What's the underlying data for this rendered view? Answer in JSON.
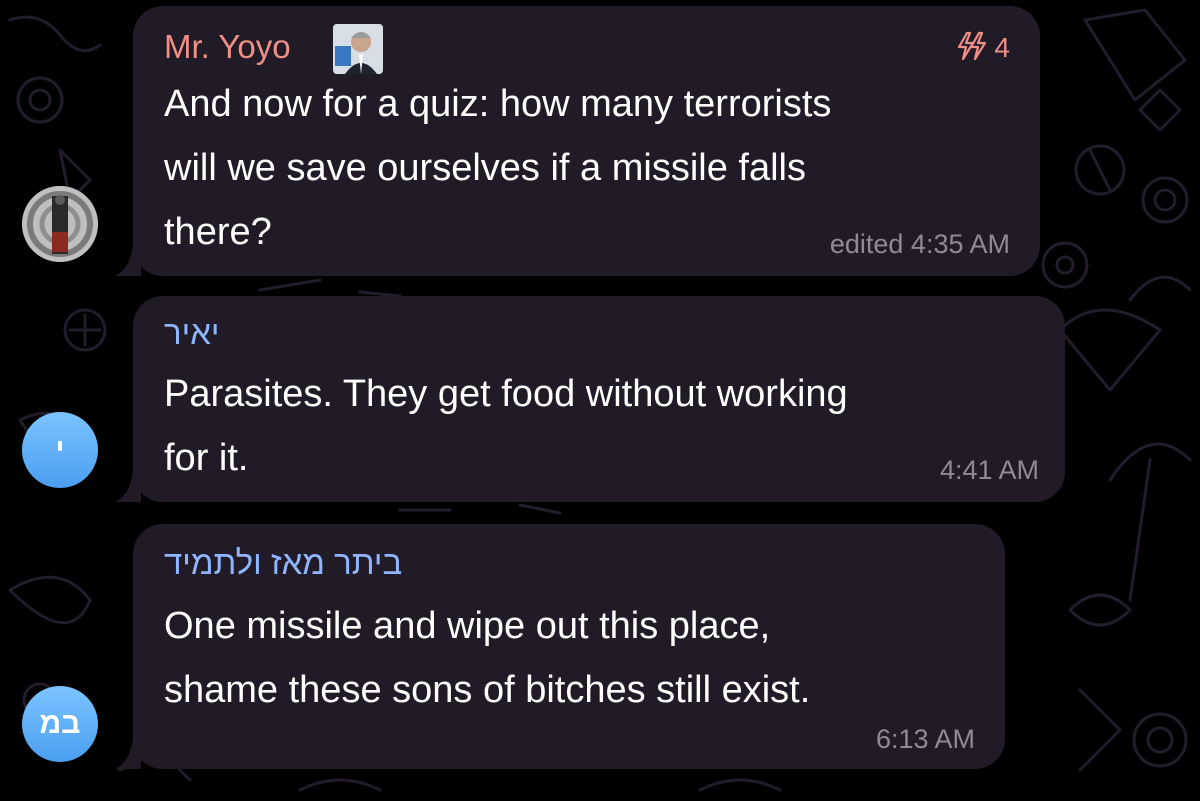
{
  "chat": {
    "messages": [
      {
        "sender": "Mr. Yoyo",
        "sender_color": "#f08f86",
        "sender_emoji": "portrait-emoji",
        "boosts": "4",
        "boost_icon": "lightning-boost-icon",
        "text_lines": [
          "And now for a quiz: how many terrorists",
          "will we save ourselves if a missile falls",
          "there?"
        ],
        "time": "edited 4:35 AM",
        "avatar": "photo"
      },
      {
        "sender": "יאיר",
        "sender_color": "#8fb5ff",
        "text_lines": [
          "Parasites. They get food without working",
          "for it."
        ],
        "time": "4:41 AM",
        "avatar_initials": "י"
      },
      {
        "sender": "ביתר מאז ולתמיד",
        "sender_color": "#8fb5ff",
        "text_lines": [
          "One missile and wipe out this place,",
          "shame these sons of bitches still exist."
        ],
        "time": "6:13 AM",
        "avatar_initials": "במ"
      }
    ]
  },
  "colors": {
    "background": "#000000",
    "bubble": "#201b26",
    "time_text": "#908a98",
    "avatar_blue": "#5aaaf5"
  }
}
